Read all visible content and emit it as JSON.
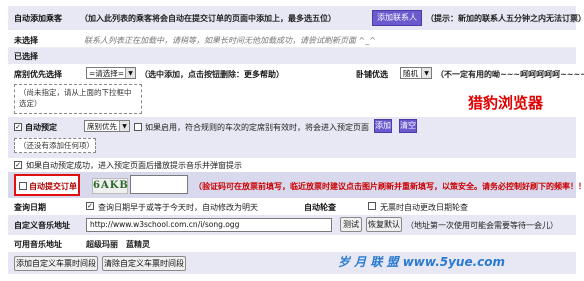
{
  "header": {
    "label": "自动添加乘客",
    "note": "（加入此列表的乘客将会自动在提交订单的页面中添加上，最多选五位）",
    "add_button": "添加联系人",
    "tip": "（提示：新加的联系人五分钟之内无法订票）"
  },
  "unselected": {
    "label": "未选择",
    "hint": "联系人列表正在加载中，请稍等，如果长时间无他加载成功，请尝试刷新页面 ^_^"
  },
  "selected": {
    "label": "已选择"
  },
  "seat_priority": {
    "label": "席别优先选择",
    "select_value": "=请选择=",
    "desc": "（选中添加，点击按钮删除：",
    "more_help": "更多帮助",
    "desc_end": "）",
    "sleeper_label": "卧铺优选",
    "sleeper_value": "随机",
    "sleeper_desc": "（不一定有用的呦~~~呵呵呵呵呵~~~~）",
    "not_specified": "（尚未指定，请从上面的下拉框中选定）"
  },
  "watermark_brand": "猎豹浏览器",
  "auto_preset": {
    "label": "自动预定",
    "select_value": "席别优先",
    "desc": "如果启用，符合规则的车次的定席别有效时，将会进入预定页面",
    "add_button": "添加",
    "clear_button": "清空",
    "none_added": "（还没有添加任何项）"
  },
  "success_tip": "如果自动预定成功，进入预定页面后播放提示音乐并弹窗提示",
  "auto_submit": {
    "label": "自动提交订单",
    "captcha": "6AKB",
    "warning": "（验证码可在放票前填写，临近放票时建议点击图片刷新并重新填写，以策安全。请务必控制好刷下的频率！！）"
  },
  "query_date": {
    "label": "查询日期",
    "desc": "查询日期早于或等于今天时，自动修改为明天",
    "auto_check_label": "自动轮查",
    "auto_check_desc": "无票时自动更改日期轮查"
  },
  "custom_sound": {
    "label": "自定义音乐地址",
    "url": "http://www.w3school.com.cn/i/song.ogg",
    "test_button": "测试",
    "restore_button": "恢复默认",
    "desc": "（地址第一次使用可能会需要等待一会儿）"
  },
  "available_sounds": {
    "label": "可用音乐地址",
    "items": [
      "超级玛丽",
      "蓝精灵"
    ]
  },
  "bottom_buttons": {
    "add_time": "添加自定义车票时间段",
    "clear_time": "清除自定义车票时间段"
  },
  "watermark_site": "岁 月 联 盟   www.5yue.com"
}
